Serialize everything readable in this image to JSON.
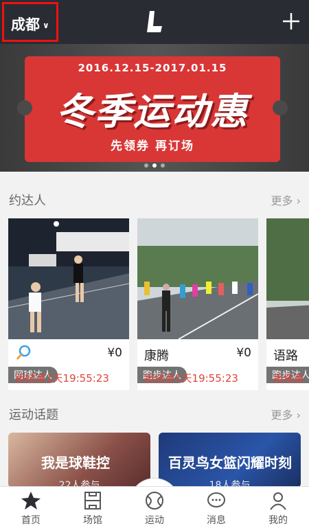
{
  "header": {
    "city": "成都",
    "logo_text": "L"
  },
  "banner": {
    "date_range": "2016.12.15-2017.01.15",
    "title": "冬季运动惠",
    "subtitle": "先领券  再订场",
    "active_dot": 1
  },
  "section_people": {
    "title": "约达人",
    "more": "更多 ›"
  },
  "cards": [
    {
      "tag": "网球达人",
      "name": "",
      "price": "¥0",
      "countdown": "距结束1天19:55:23",
      "sport_icon": "tennis-racket-icon"
    },
    {
      "tag": "跑步达人",
      "name": "康腾",
      "price": "¥0",
      "countdown": "距结束1天19:55:23"
    },
    {
      "tag": "跑步达人",
      "name": "语路",
      "price": "",
      "countdown": "距结束"
    }
  ],
  "section_topics": {
    "title": "运动话题",
    "more": "更多 ›"
  },
  "topics": [
    {
      "title": "我是球鞋控",
      "count": "22人参与"
    },
    {
      "title": "百灵鸟女篮闪耀时刻",
      "count": "18人参与"
    }
  ],
  "tabs": [
    {
      "label": "首页",
      "icon": "star-icon"
    },
    {
      "label": "场馆",
      "icon": "venue-icon"
    },
    {
      "label": "运动",
      "icon": "ball-icon"
    },
    {
      "label": "消息",
      "icon": "message-icon"
    },
    {
      "label": "我的",
      "icon": "profile-icon"
    }
  ],
  "colors": {
    "header_bg": "#2a2c33",
    "accent_red": "#e0433b",
    "banner_red": "#d93636"
  }
}
